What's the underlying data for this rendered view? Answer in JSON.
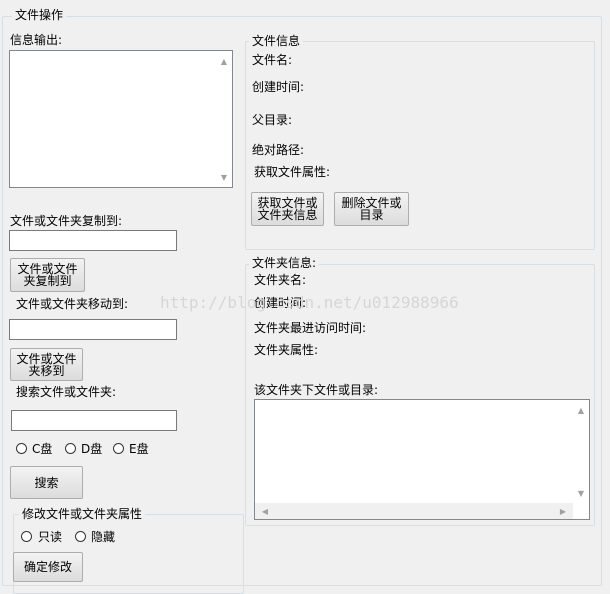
{
  "file_ops": {
    "legend": "文件操作",
    "info_output_label": "信息输出:",
    "copy_to_label": "文件或文件夹复制到:",
    "copy_to_value": "",
    "copy_button": "文件或文件\n夹复制到",
    "move_to_label": "文件或文件夹移动到:",
    "move_to_value": "",
    "move_button": "文件或文件\n夹移到",
    "search_label": "搜索文件或文件夹:",
    "search_value": "",
    "drives": [
      "C盘",
      "D盘",
      "E盘"
    ],
    "search_button": "搜索"
  },
  "attributes": {
    "legend": "修改文件或文件夹属性",
    "options": [
      "只读",
      "隐藏"
    ],
    "confirm_button": "确定修改"
  },
  "file_info": {
    "legend": "文件信息",
    "name_label": "文件名:",
    "created_label": "创建时间:",
    "parent_label": "父目录:",
    "abs_path_label": "绝对路径:",
    "attr_label": "获取文件属性:",
    "get_info_button": "获取文件或\n文件夹信息",
    "delete_button": "删除文件或\n目录"
  },
  "folder_info": {
    "legend": "文件夹信息:",
    "name_label": "文件夹名:",
    "created_label": "创建时间:",
    "last_access_label": "文件夹最进访问时间:",
    "attr_label": "文件夹属性:",
    "contents_label": "该文件夹下文件或目录:"
  },
  "watermark": "http://blog.csdn.net/u012988966"
}
